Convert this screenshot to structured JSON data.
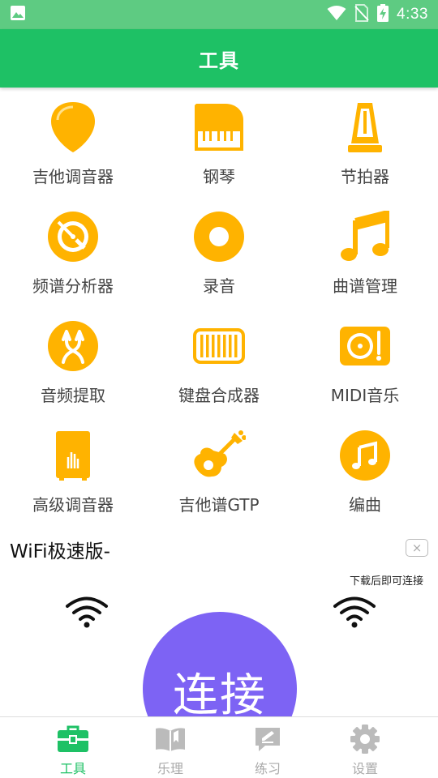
{
  "status_bar": {
    "time": "4:33"
  },
  "app_bar": {
    "title": "工具"
  },
  "tools": [
    {
      "label": "吉他调音器",
      "icon": "guitar-pick-icon"
    },
    {
      "label": "钢琴",
      "icon": "piano-icon"
    },
    {
      "label": "节拍器",
      "icon": "metronome-icon"
    },
    {
      "label": "频谱分析器",
      "icon": "spectrum-disc-icon"
    },
    {
      "label": "录音",
      "icon": "record-icon"
    },
    {
      "label": "曲谱管理",
      "icon": "music-notes-icon"
    },
    {
      "label": "音频提取",
      "icon": "audio-extract-icon"
    },
    {
      "label": "键盘合成器",
      "icon": "keyboard-synth-icon"
    },
    {
      "label": "MIDI音乐",
      "icon": "midi-turntable-icon"
    },
    {
      "label": "高级调音器",
      "icon": "advanced-tuner-icon"
    },
    {
      "label": "吉他谱GTP",
      "icon": "guitar-icon"
    },
    {
      "label": "编曲",
      "icon": "music-note-circle-icon"
    }
  ],
  "ad": {
    "title": "WiFi极速版-",
    "close": "×",
    "subtitle": "下载后即可连接",
    "button": "连接"
  },
  "bottom_nav": [
    {
      "label": "工具",
      "icon": "toolbox-icon",
      "active": true
    },
    {
      "label": "乐理",
      "icon": "book-icon",
      "active": false
    },
    {
      "label": "练习",
      "icon": "practice-icon",
      "active": false
    },
    {
      "label": "设置",
      "icon": "gear-icon",
      "active": false
    }
  ],
  "colors": {
    "status_bar": "#5ecb82",
    "app_bar": "#1ec165",
    "icon_accent": "#ffb300",
    "connect_button": "#7d63f4",
    "nav_active": "#1ec165",
    "nav_inactive": "#aaaaaa"
  }
}
